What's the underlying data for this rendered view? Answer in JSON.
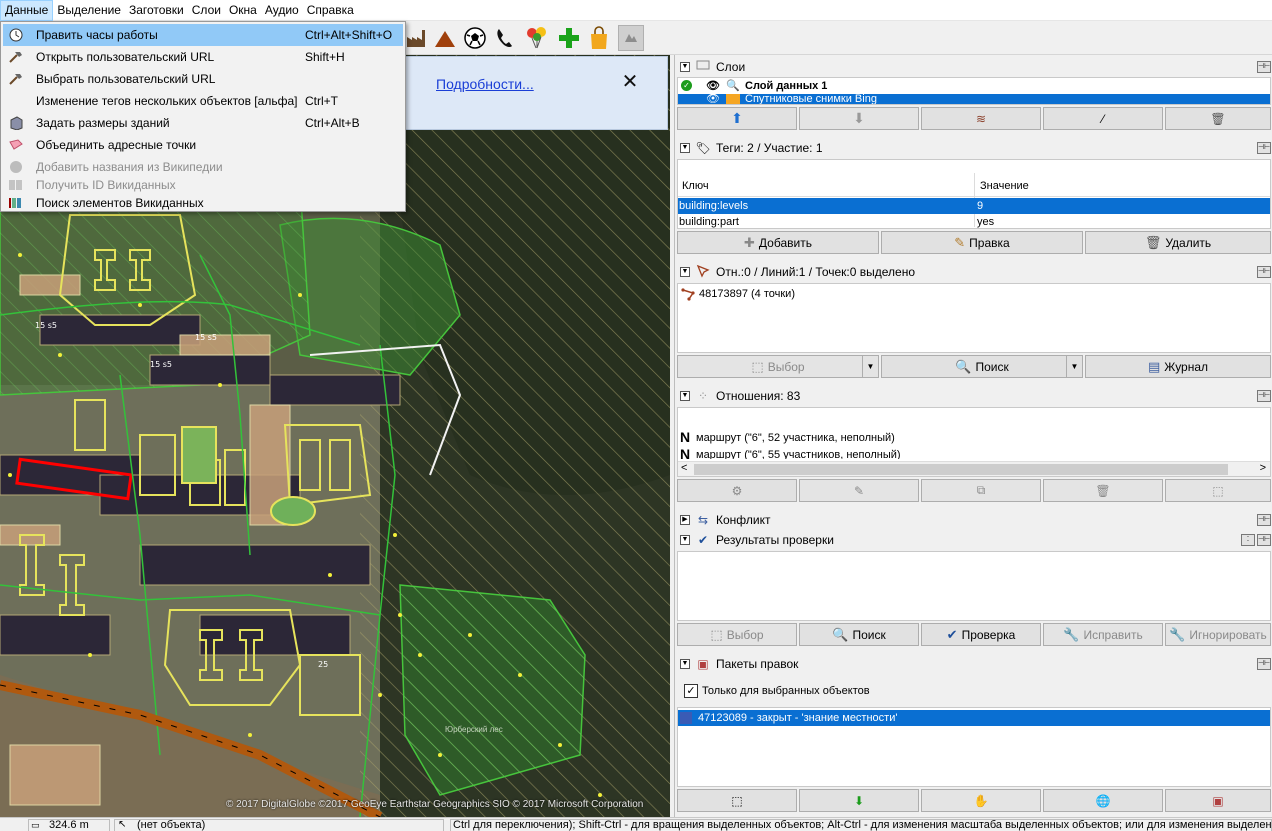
{
  "menu": {
    "items": [
      "Данные",
      "Выделение",
      "Заготовки",
      "Слои",
      "Окна",
      "Аудио",
      "Справка"
    ],
    "open_index": 0
  },
  "dropdown": {
    "items": [
      {
        "label": "Править часы работы",
        "shortcut": "Ctrl+Alt+Shift+O",
        "icon": "clock-icon",
        "highlighted": true,
        "enabled": true
      },
      {
        "label": "Открыть пользовательский URL",
        "shortcut": "Shift+H",
        "icon": "hammer-icon",
        "enabled": true
      },
      {
        "label": "Выбрать пользовательский URL",
        "shortcut": "",
        "icon": "hammer-icon",
        "enabled": true
      },
      {
        "label": "Изменение тегов нескольких объектов [альфа]",
        "shortcut": "Ctrl+T",
        "icon": "",
        "enabled": true
      },
      {
        "label": "Задать размеры зданий",
        "shortcut": "Ctrl+Alt+B",
        "icon": "building-icon",
        "enabled": true
      },
      {
        "label": "Объединить адресные точки",
        "shortcut": "",
        "icon": "merge-icon",
        "enabled": true
      },
      {
        "label": "Добавить названия из Википедии",
        "shortcut": "",
        "icon": "wikipedia-icon",
        "enabled": false
      },
      {
        "label": "Получить ID Викиданных",
        "shortcut": "",
        "icon": "barcode-icon",
        "enabled": false
      },
      {
        "label": "Поиск элементов Викиданных",
        "shortcut": "",
        "icon": "wikidata-icon",
        "enabled": true
      }
    ]
  },
  "notification": {
    "link": "Подробности...",
    "close": "✕"
  },
  "toolbar": {
    "icons": [
      "factory-icon",
      "mountain-icon",
      "football-icon",
      "phone-icon",
      "balloons-icon",
      "medical-cross-icon",
      "shopping-bag-icon",
      "more-icon"
    ]
  },
  "map": {
    "credit": "© 2017 DigitalGlobe ©2017 GeoEye Earthstar Geographics SIO © 2017 Microsoft Corporation",
    "forest_label": "Юрберский лес",
    "building_labels": [
      "15 s5",
      "15 s5",
      "15 s5",
      "25"
    ]
  },
  "layers": {
    "title": "Слои",
    "items": [
      {
        "name": "Слой данных 1",
        "active": true,
        "visible": true
      },
      {
        "name": "Спутниковые снимки Bing",
        "active": false,
        "visible": true,
        "selected": true
      }
    ]
  },
  "tags": {
    "title": "Теги: 2 / Участие: 1",
    "columns": [
      "Ключ",
      "Значение"
    ],
    "rows": [
      {
        "key": "building:levels",
        "value": "9",
        "selected": true
      },
      {
        "key": "building:part",
        "value": "yes",
        "selected": false
      }
    ],
    "buttons": [
      "Добавить",
      "Правка",
      "Удалить"
    ]
  },
  "selection": {
    "title": "Отн.:0 / Линий:1 / Точек:0 выделено",
    "items": [
      "48173897 (4 точки)"
    ],
    "buttons": [
      "Выбор",
      "Поиск",
      "Журнал"
    ]
  },
  "relations": {
    "title": "Отношения: 83",
    "items": [
      "маршрут (\"6\", 52 участника, неполный)",
      "маршрут (\"6\", 55 участников, неполный)"
    ]
  },
  "conflict": {
    "title": "Конфликт"
  },
  "validation": {
    "title": "Результаты проверки",
    "buttons": [
      "Выбор",
      "Поиск",
      "Проверка",
      "Исправить",
      "Игнорировать"
    ]
  },
  "changesets": {
    "title": "Пакеты правок",
    "checkbox_label": "Только для выбранных объектов",
    "checkbox_checked": true,
    "items": [
      "47123089 - закрыт - 'знание местности'"
    ]
  },
  "status": {
    "scale": "324.6 m",
    "object": "(нет объекта)",
    "hint": "Ctrl для переключения); Shift-Ctrl - для вращения выделенных объектов; Alt-Ctrl - для изменения масштаба выделенных объектов; или для изменения выделения"
  },
  "colors": {
    "selection_blue": "#0a6fd2",
    "menu_highlight": "#91c9f7",
    "notification_bg": "#dde8f7",
    "building_outline": "#e0e05a",
    "landuse_green": "#3fbf3f",
    "selected_way": "#ff0000"
  }
}
